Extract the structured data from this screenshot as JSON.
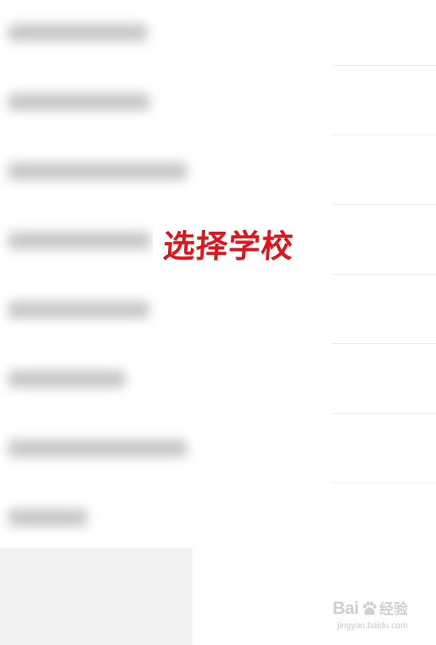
{
  "overlay": {
    "caption": "选择学校",
    "caption_color": "#e0141b"
  },
  "school_list": {
    "item_count": 8,
    "items": [
      "",
      "",
      "",
      "",
      "",
      "",
      "",
      ""
    ]
  },
  "watermark": {
    "brand": "Bai",
    "icon": "paw-icon",
    "cn": "经验",
    "url": "jingyan.baidu.com"
  },
  "colors": {
    "background": "#ffffff",
    "divider": "#ececec",
    "panel": "#f3f3f3"
  }
}
